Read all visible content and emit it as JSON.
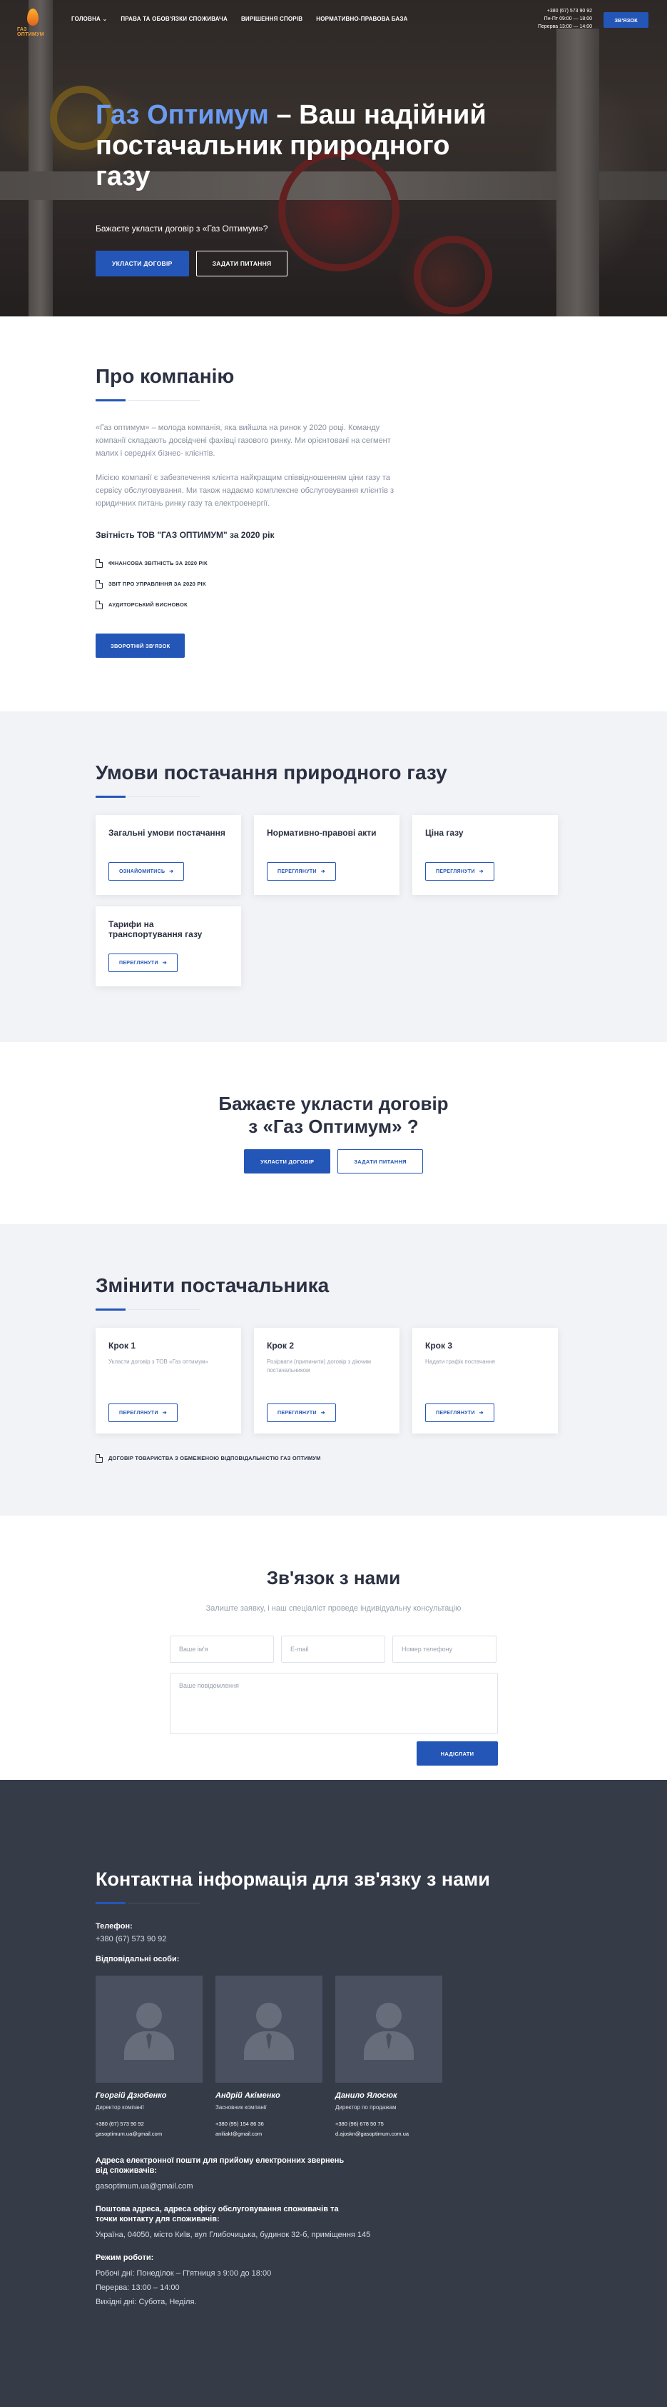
{
  "header": {
    "logo_text": "ГАЗ ОПТИМУМ",
    "menu": [
      "ГОЛОВНА ⌄",
      "ПРАВА ТА ОБОВ'ЯЗКИ СПОЖИВАЧА",
      "ВИРІШЕННЯ СПОРІВ",
      "НОРМАТИВНО-ПРАВОВА БАЗА"
    ],
    "phone": "+380 (67) 573 90 92",
    "hours_line1": "Пн-Пт 09:00 — 18:00",
    "hours_line2": "Перерва 13:00 — 14:00",
    "cta_label": "ЗВ'ЯЗОК"
  },
  "hero": {
    "title_accent": "Газ Оптимум",
    "title_rest": " – Ваш надійний постачальник природного газу",
    "subtitle": "Бажаєте укласти договір з «Газ Оптимум»?",
    "primary_label": "УКЛАСТИ ДОГОВІР",
    "secondary_label": "ЗАДАТИ ПИТАННЯ"
  },
  "about": {
    "title": "Про компанію",
    "para1": "«Газ оптимум» – молода компанія, яка вийшла на ринок у 2020 році. Команду компанії складають досвідчені фахівці газового ринку. Ми орієнтовані на сегмент малих і середніх бізнес- клієнтів.",
    "para2": "Місією компанії є забезпечення клієнта найкращим співвідношенням ціни газу та сервісу обслуговування. Ми також надаємо комплексне обслуговування клієнтів з юридичних питань ринку газу та електроенергії.",
    "report_title": "Звітність ТОВ \"ГАЗ ОПТИМУМ\" за 2020 рік",
    "docs": [
      "ФІНАНСОВА ЗВІТНІСТЬ ЗА 2020 РІК",
      "ЗВІТ ПРО УПРАВЛІННЯ ЗА 2020 РІК",
      "АУДИТОРСЬКИЙ ВИСНОВОК"
    ],
    "button_label": "ЗВОРОТНІЙ ЗВ'ЯЗОК"
  },
  "terms": {
    "title": "Умови постачання природного газу",
    "cards": [
      {
        "title": "Загальні умови постачання",
        "button": "ОЗНАЙОМИТИСЬ"
      },
      {
        "title": "Нормативно-правові акти",
        "button": "ПЕРЕГЛЯНУТИ"
      },
      {
        "title": "Ціна газу",
        "button": "ПЕРЕГЛЯНУТИ"
      },
      {
        "title": "Тарифи на транспортування газу",
        "button": "ПЕРЕГЛЯНУТИ"
      }
    ]
  },
  "cta": {
    "title_line1": "Бажаєте укласти договір",
    "title_line2": "з «Газ Оптимум» ?",
    "primary_label": "УКЛАСТИ ДОГОВІР",
    "secondary_label": "ЗАДАТИ ПИТАННЯ"
  },
  "change": {
    "title": "Змінити постачальника",
    "steps": [
      {
        "title": "Крок 1",
        "text": "Укласти договір з ТОВ «Газ оптимум»",
        "button": "ПЕРЕГЛЯНУТИ"
      },
      {
        "title": "Крок 2",
        "text": "Розірвати (припинити) договір з діючим постачальником",
        "button": "ПЕРЕГЛЯНУТИ"
      },
      {
        "title": "Крок 3",
        "text": "Надати графік постачання",
        "button": "ПЕРЕГЛЯНУТИ"
      }
    ],
    "doc": "ДОГОВІР ТОВАРИСТВА З ОБМЕЖЕНОЮ ВІДПОВІДАЛЬНІСТЮ ГАЗ ОПТИМУМ"
  },
  "contact": {
    "title": "Зв'язок з нами",
    "subtitle": "Залиште заявку, і наш спеціаліст проведе індивідуальну консультацію",
    "name_placeholder": "Ваше ім'я",
    "email_placeholder": "E-mail",
    "phone_placeholder": "Номер телефону",
    "message_placeholder": "Ваше повідомлення",
    "submit_label": "НАДІСЛАТИ"
  },
  "footer": {
    "title": "Контактна інформація для зв'язку з нами",
    "phone_label": "Телефон:",
    "phone": "+380 (67) 573 90 92",
    "persons_label": "Відповідальні особи:",
    "persons": [
      {
        "name": "Георгій Дзюбенко",
        "role": "Директор компанії",
        "phone": "+380 (67) 573 90 92",
        "email": "gasoptimum.ua@gmail.com"
      },
      {
        "name": "Андрій Акіменко",
        "role": "Засновник компанії",
        "phone": "+380 (95) 154 86 36",
        "email": "aniliakI@gmail.com"
      },
      {
        "name": "Данило Ялосюк",
        "role": "Директор по продажам",
        "phone": "+380 (96) 678 50 75",
        "email": "d.ajoskn@gasoptimum.com.ua"
      }
    ],
    "email_label": "Адреса електронної пошти для прийому електронних звернень від споживачів:",
    "email": "gasoptimum.ua@gmail.com",
    "address_label": "Поштова адреса, адреса офісу обслуговування споживачів та точки контакту для споживачів:",
    "address": "Україна, 04050, місто Київ, вул Глибочицька, будинок 32-б, приміщення 145",
    "hours_label": "Режим роботи:",
    "hours1": "Робочі дні: Понеділок – П'ятниця з 9:00 до 18:00",
    "hours2": "Перерва: 13:00 – 14:00",
    "hours3": "Вихідні дні: Субота, Неділя."
  },
  "colors": {
    "accent": "#2456b8",
    "accent_light": "#6b9cf2",
    "footer_bg": "#363b48",
    "section_bg": "#f2f3f7"
  }
}
